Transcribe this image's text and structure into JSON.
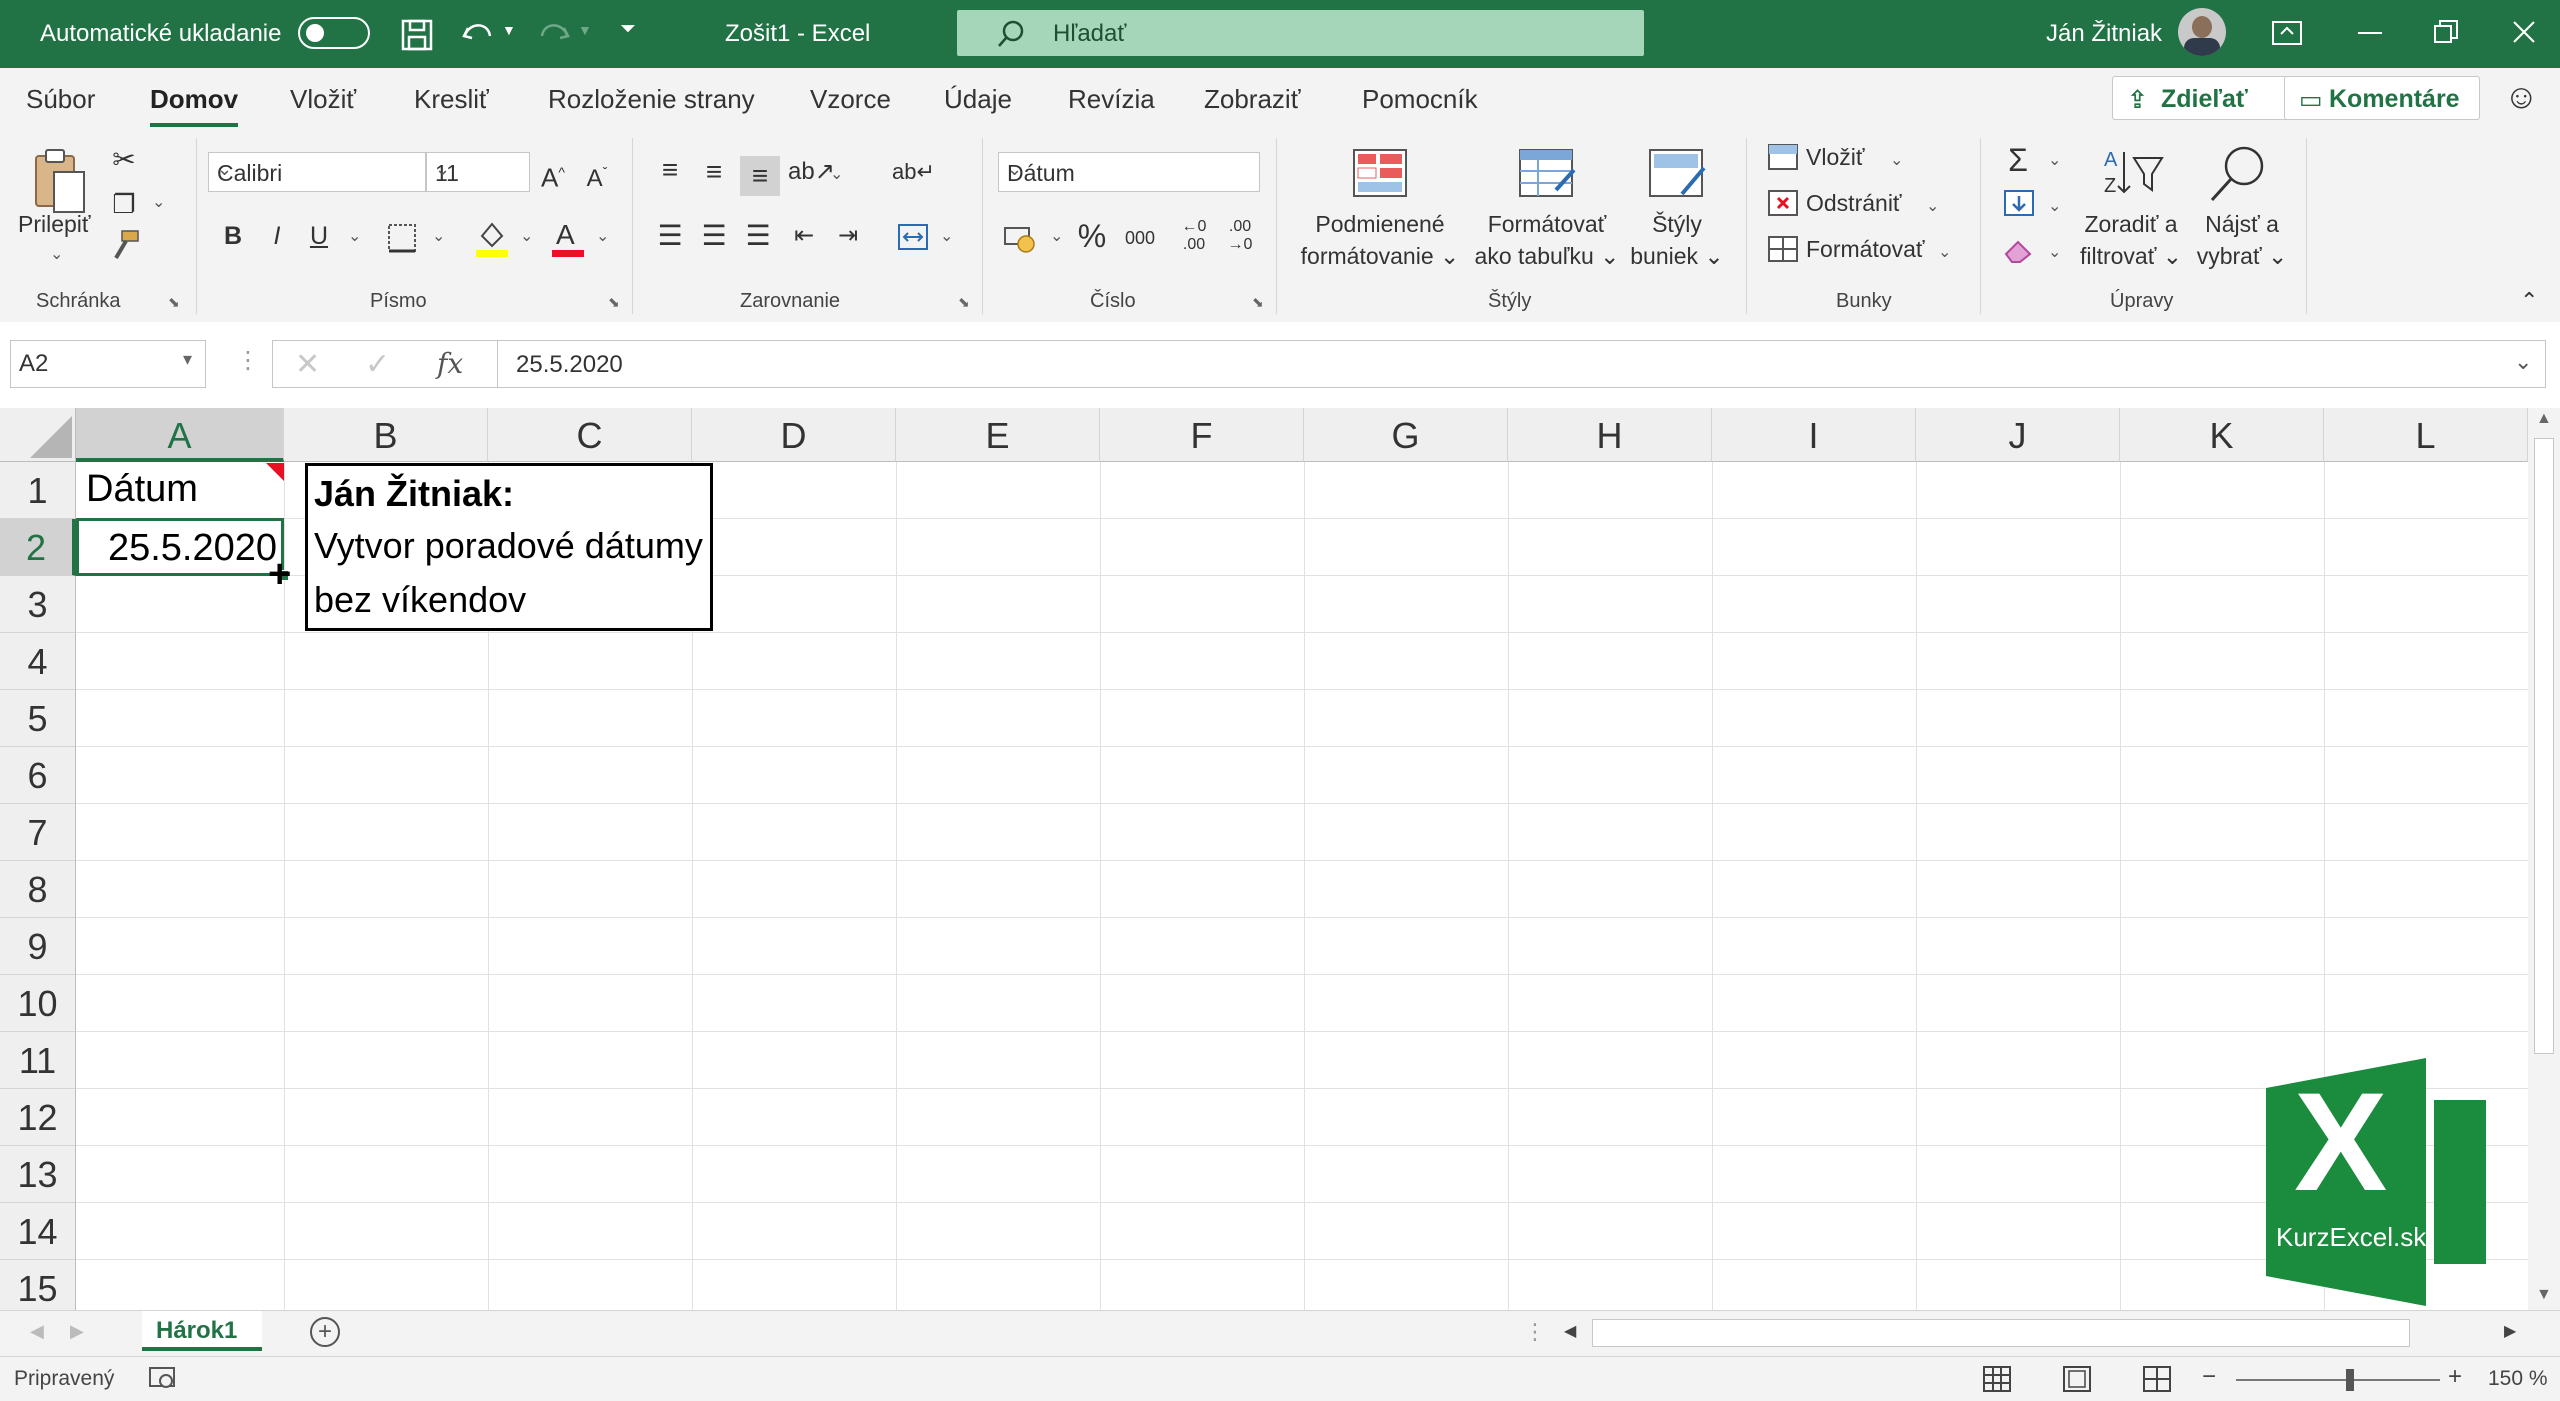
{
  "titlebar": {
    "autosave_label": "Automatické ukladanie",
    "doc_title": "Zošit1  -  Excel",
    "search_placeholder": "Hľadať",
    "user_name": "Ján Žitniak"
  },
  "tabs": [
    "Súbor",
    "Domov",
    "Vložiť",
    "Kresliť",
    "Rozloženie strany",
    "Vzorce",
    "Údaje",
    "Revízia",
    "Zobraziť",
    "Pomocník"
  ],
  "share_label": "Zdieľať",
  "comments_label": "Komentáre",
  "ribbon": {
    "clipboard": {
      "paste": "Prilepiť",
      "label": "Schránka"
    },
    "font": {
      "name": "Calibri",
      "size": "11",
      "label": "Písmo",
      "bold": "B",
      "italic": "I",
      "underline": "U"
    },
    "alignment": {
      "label": "Zarovnanie"
    },
    "number": {
      "format": "Dátum",
      "label": "Číslo",
      "percent": "%",
      "thousands": "000"
    },
    "styles": {
      "conditional_1": "Podmienené",
      "conditional_2": "formátovanie",
      "table_1": "Formátovať",
      "table_2": "ako tabuľku",
      "cell_1": "Štýly",
      "cell_2": "buniek",
      "label": "Štýly"
    },
    "cells": {
      "insert": "Vložiť",
      "delete": "Odstrániť",
      "format": "Formátovať",
      "label": "Bunky"
    },
    "editing": {
      "sort_1": "Zoradiť a",
      "sort_2": "filtrovať",
      "find_1": "Nájsť a",
      "find_2": "vybrať",
      "label": "Úpravy"
    }
  },
  "formula_bar": {
    "name_box": "A2",
    "fx": "fx",
    "value": "25.5.2020"
  },
  "columns": [
    "A",
    "B",
    "C",
    "D",
    "E",
    "F",
    "G",
    "H",
    "I",
    "J",
    "K",
    "L"
  ],
  "rows": [
    "1",
    "2",
    "3",
    "4",
    "5",
    "6",
    "7",
    "8",
    "9",
    "10",
    "11",
    "12",
    "13",
    "14",
    "15"
  ],
  "cells": {
    "A1": "Dátum",
    "A2": "25.5.2020"
  },
  "comment": {
    "author": "Ján Žitniak:",
    "line1": "Vytvor poradové dátumy",
    "line2": "bez víkendov"
  },
  "logo": {
    "letter": "X",
    "text": "KurzExcel.sk"
  },
  "sheet_tab": "Hárok1",
  "status": {
    "ready": "Pripravený",
    "zoom": "150 %"
  },
  "colors": {
    "accent": "#217346",
    "search": "#a6d6b9",
    "comment_marker": "#e81123"
  }
}
